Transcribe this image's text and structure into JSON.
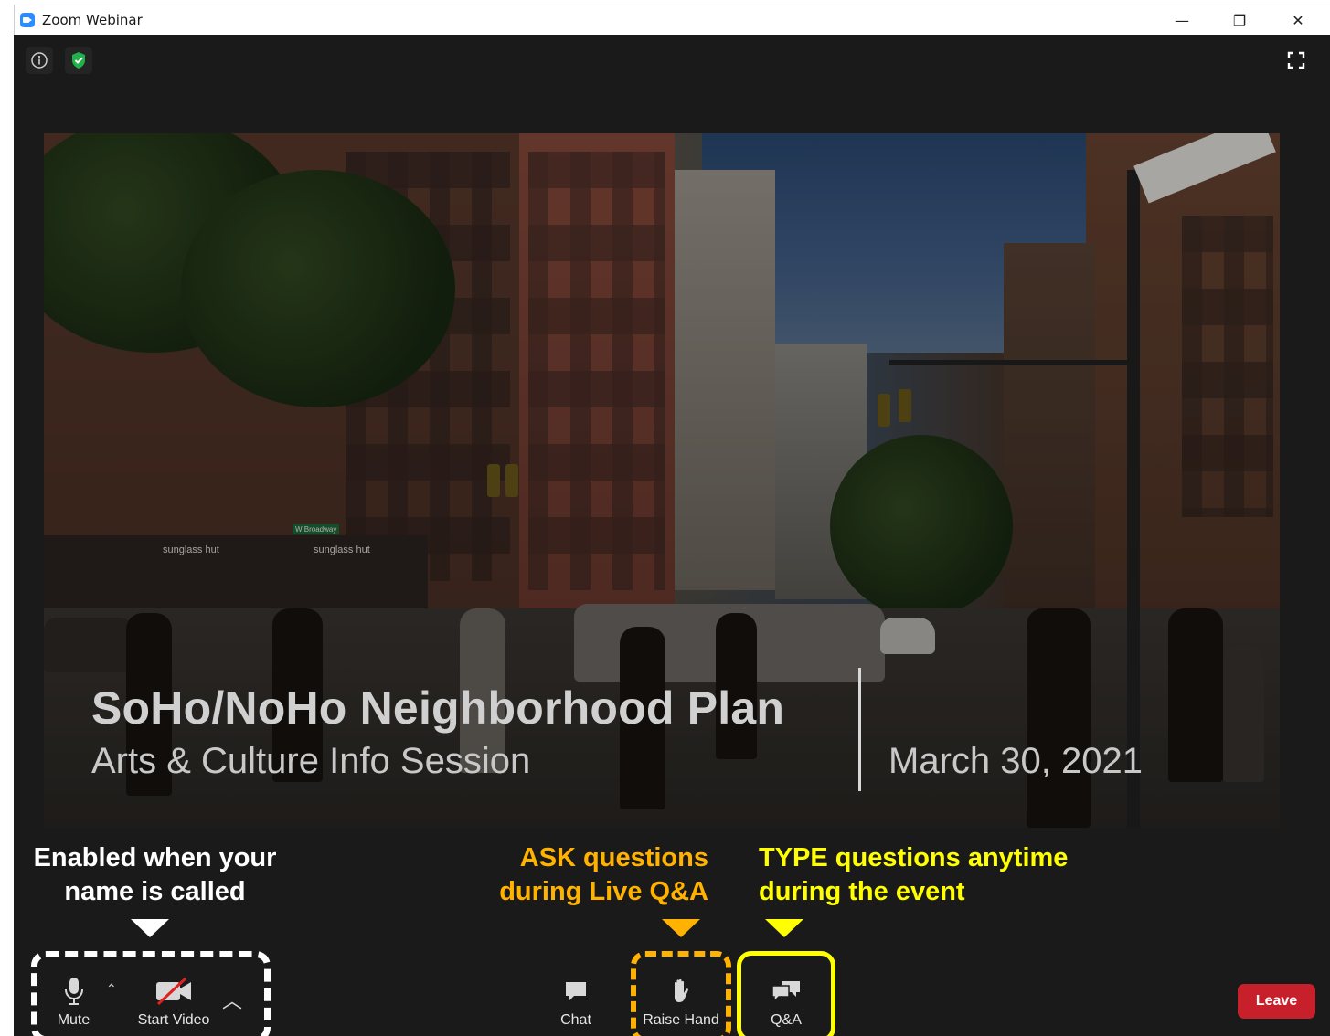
{
  "window": {
    "title": "Zoom Webinar",
    "minimize": "—",
    "maximize": "❐",
    "close": "✕"
  },
  "top_icons": {
    "info": "info-icon",
    "security": "shield-check-icon",
    "fullscreen": "fullscreen-icon"
  },
  "slide": {
    "title": "SoHo/NoHo Neighborhood Plan",
    "subtitle": "Arts & Culture Info Session",
    "date": "March 30, 2021",
    "store_sign_1": "sunglass hut",
    "store_sign_2": "sunglass hut",
    "street_sign": "W Broadway"
  },
  "annotations": {
    "mute_video": [
      "Enabled when your",
      "name is called"
    ],
    "raise_hand": [
      "ASK questions",
      "during Live Q&A"
    ],
    "qa": [
      "TYPE questions anytime",
      "during the event"
    ]
  },
  "toolbar": {
    "mute_label": "Mute",
    "start_video_label": "Start Video",
    "chat_label": "Chat",
    "raise_hand_label": "Raise Hand",
    "qa_label": "Q&A",
    "leave_label": "Leave"
  },
  "colors": {
    "annotation_white": "#ffffff",
    "annotation_orange": "#ffb200",
    "annotation_yellow": "#ffff00",
    "leave_red": "#c8202a",
    "zoom_blue": "#2d8cff",
    "security_green": "#22b04b"
  }
}
